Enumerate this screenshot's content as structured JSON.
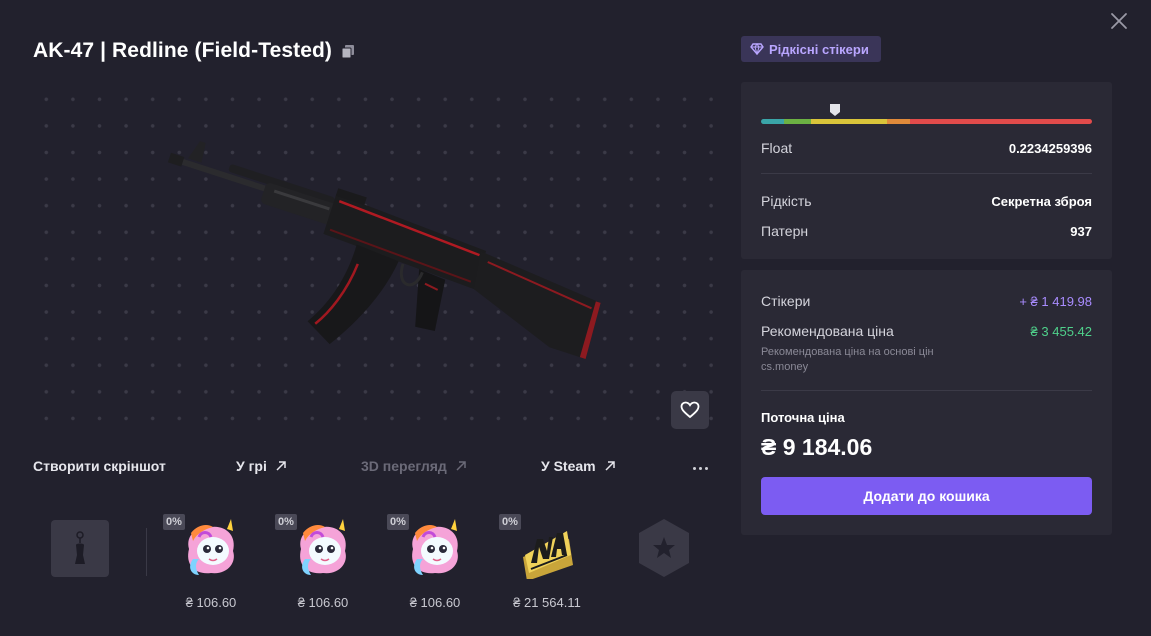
{
  "item": {
    "title": "AK-47 | Redline (Field-Tested)"
  },
  "actions": {
    "screenshot": "Створити скріншот",
    "in_game": "У грі",
    "view_3d": "3D перегляд",
    "steam": "У Steam"
  },
  "stickers": [
    {
      "wear": "0%",
      "price": "₴ 106.60",
      "icon": "unicorn-sticker"
    },
    {
      "wear": "0%",
      "price": "₴ 106.60",
      "icon": "unicorn-sticker"
    },
    {
      "wear": "0%",
      "price": "₴ 106.60",
      "icon": "unicorn-sticker"
    },
    {
      "wear": "0%",
      "price": "₴ 21 564.11",
      "icon": "navi-sticker"
    }
  ],
  "badge": {
    "label": "Рідкісні стікери",
    "icon": "diamond-icon"
  },
  "details": {
    "float_label": "Float",
    "float_value": "0.2234259396",
    "float_fraction": 0.2234259396,
    "rarity_label": "Рідкість",
    "rarity_value": "Секретна зброя",
    "pattern_label": "Патерн",
    "pattern_value": "937"
  },
  "pricing": {
    "stickers_label": "Стікери",
    "stickers_value": "+ ₴ 1 419.98",
    "recommended_label": "Рекомендована ціна",
    "recommended_value": "₴ 3 455.42",
    "recommended_note": "Рекомендована ціна на основі цін cs.money",
    "current_label": "Поточна ціна",
    "current_value": "₴ 9 184.06",
    "cart_button": "Додати до кошика"
  },
  "colors": {
    "accent": "#7c5cf2",
    "recommended": "#4fd18b",
    "stickers_price": "#a98cff",
    "background": "#22212d",
    "panel": "#2a2935"
  }
}
